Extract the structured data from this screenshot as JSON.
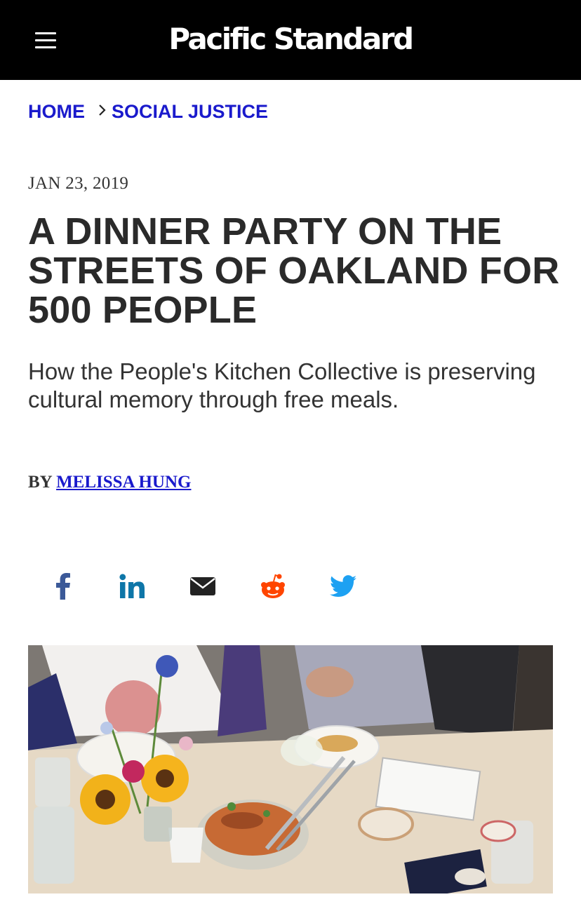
{
  "header": {
    "logo_text": "Pacific Standard",
    "menu_icon": "hamburger-menu-icon",
    "background": "#000000"
  },
  "breadcrumb": {
    "home": "HOME",
    "separator": "›",
    "section": "SOCIAL JUSTICE",
    "link_color": "#1a1acc"
  },
  "article": {
    "date": "JAN 23, 2019",
    "headline": "A DINNER PARTY ON THE STREETS OF OAKLAND FOR 500 PEOPLE",
    "dek": "How the People's Kitchen Collective is preserving cultural memory through free meals.",
    "byline_prefix": "BY",
    "author": "MELISSA HUNG"
  },
  "share": [
    {
      "icon": "facebook-icon",
      "color": "#3b5998"
    },
    {
      "icon": "linkedin-icon",
      "color": "#0e76a8"
    },
    {
      "icon": "email-icon",
      "color": "#222222"
    },
    {
      "icon": "reddit-icon",
      "color": "#ff4500"
    },
    {
      "icon": "twitter-icon",
      "color": "#1da1f2"
    }
  ],
  "hero_image": {
    "subject": "photo-dinner-table-with-sunflowers-and-food"
  }
}
